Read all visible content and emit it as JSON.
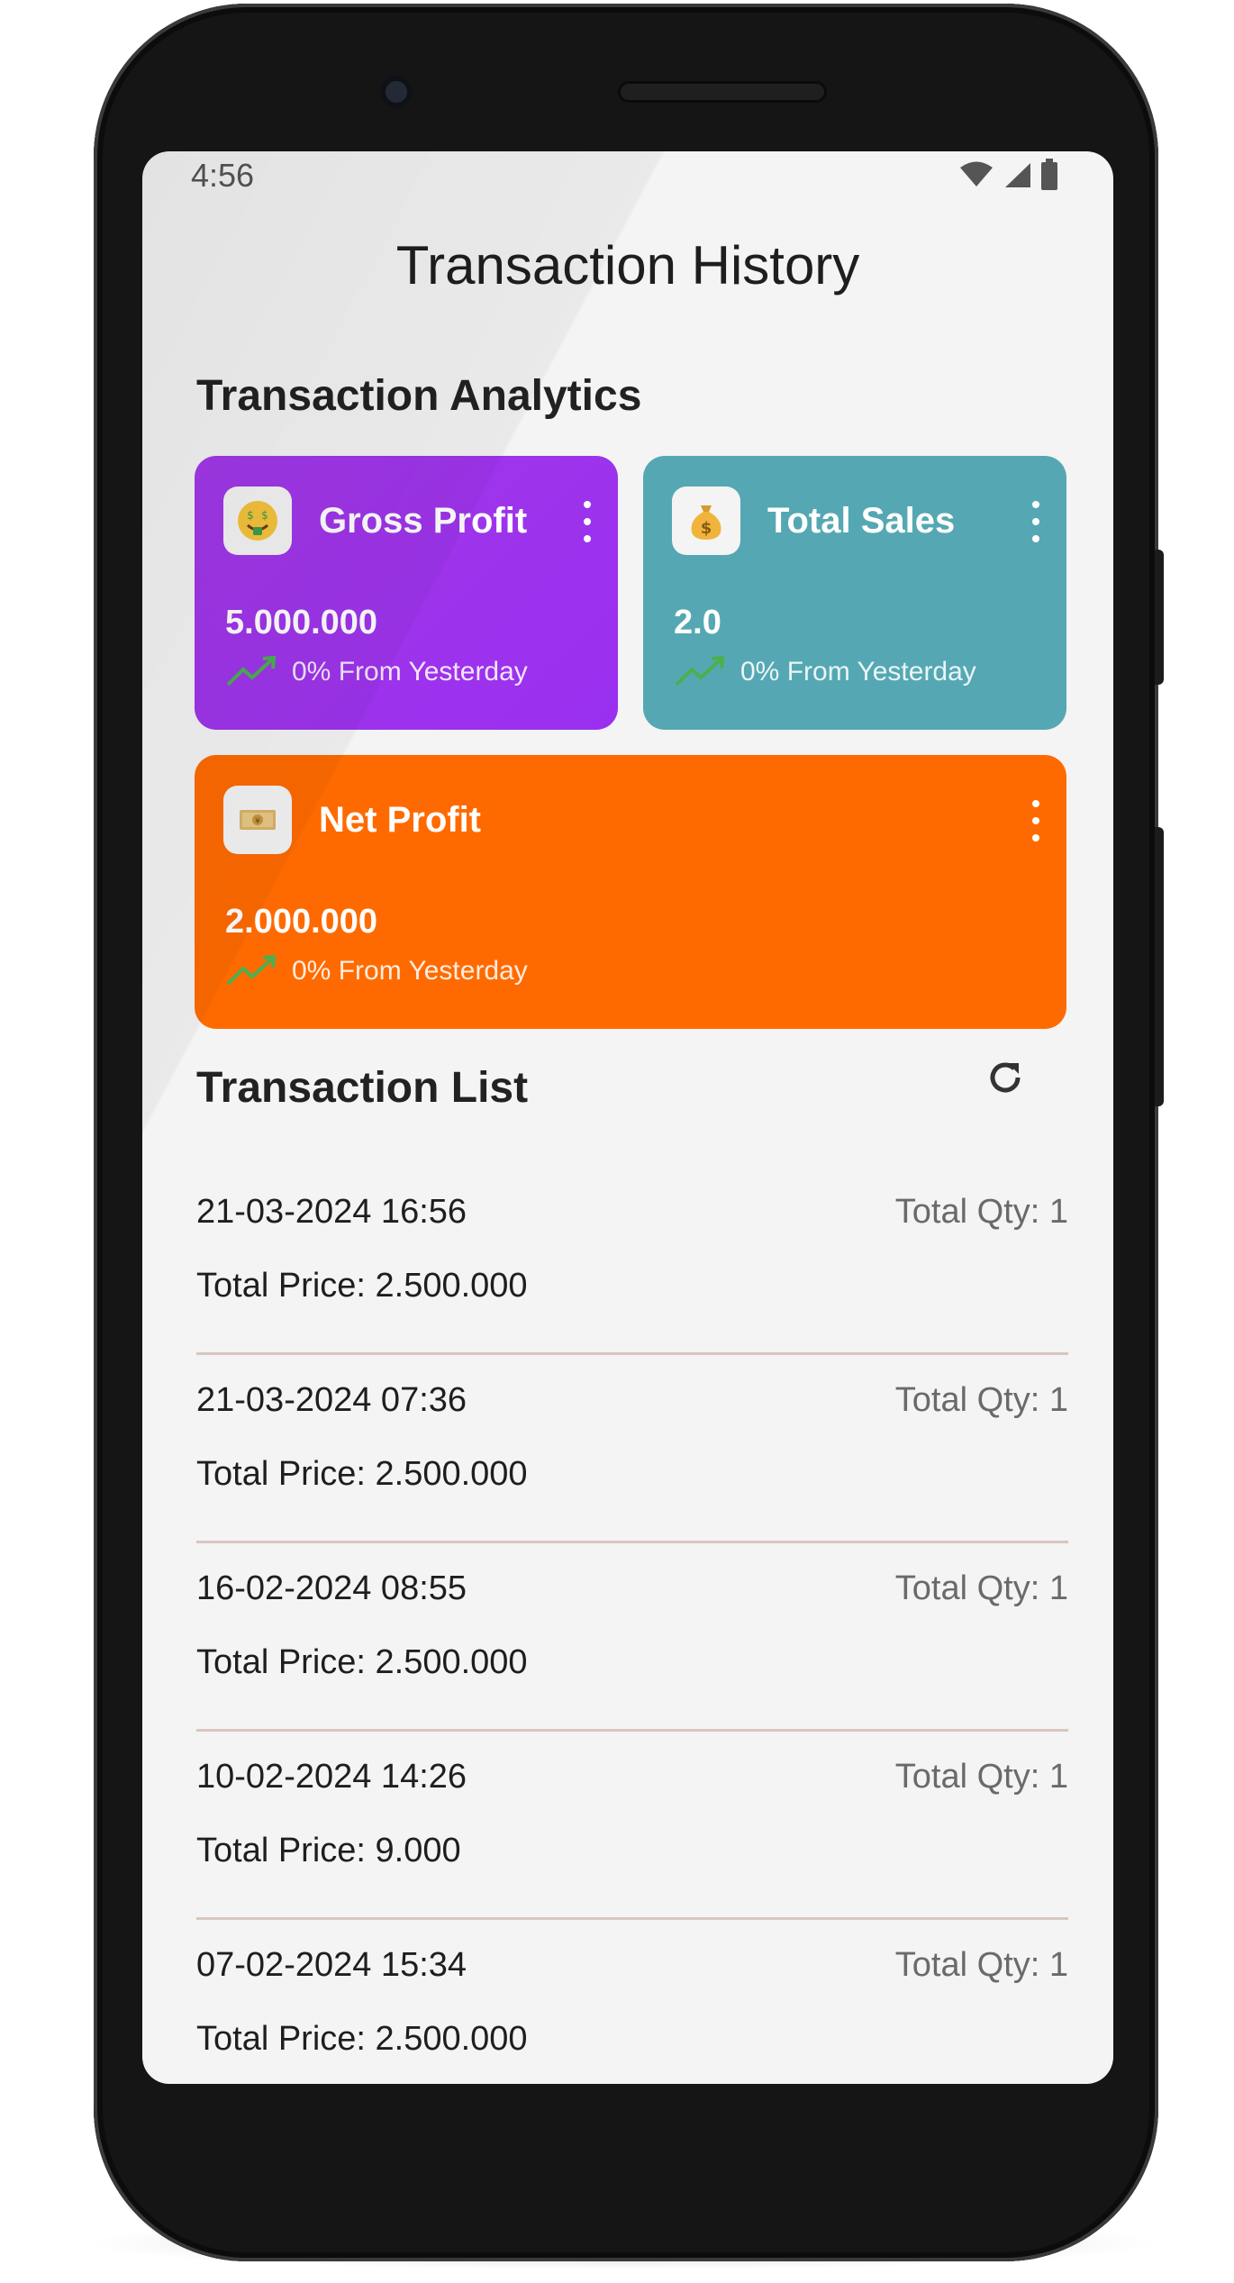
{
  "status_bar": {
    "time": "4:56",
    "icons": [
      "wifi-icon",
      "cell-signal-icon",
      "battery-icon"
    ]
  },
  "header": {
    "title": "Transaction History"
  },
  "analytics": {
    "title": "Transaction Analytics",
    "cards": [
      {
        "label": "Gross Profit",
        "value": "5.000.000",
        "trend": "0% From Yesterday",
        "icon": "money-mouth-face-icon",
        "color": "#9c34e8"
      },
      {
        "label": "Total Sales",
        "value": "2.0",
        "trend": "0% From Yesterday",
        "icon": "money-bag-icon",
        "color": "#55a8b3"
      },
      {
        "label": "Net Profit",
        "value": "2.000.000",
        "trend": "0% From Yesterday",
        "icon": "yen-banknote-icon",
        "color": "#ff6a00"
      }
    ]
  },
  "transactions": {
    "title": "Transaction List",
    "refresh_icon": "refresh-icon",
    "items": [
      {
        "date": "21-03-2024 16:56",
        "qty": "Total Qty: 1",
        "price": "Total Price: 2.500.000"
      },
      {
        "date": "21-03-2024 07:36",
        "qty": "Total Qty: 1",
        "price": "Total Price: 2.500.000"
      },
      {
        "date": "16-02-2024 08:55",
        "qty": "Total Qty: 1",
        "price": "Total Price: 2.500.000"
      },
      {
        "date": "10-02-2024 14:26",
        "qty": "Total Qty: 1",
        "price": "Total Price: 9.000"
      },
      {
        "date": "07-02-2024 15:34",
        "qty": "Total Qty: 1",
        "price": "Total Price: 2.500.000"
      }
    ]
  },
  "colors": {
    "background": "#f4f4f4",
    "trend_green": "#4caf50",
    "divider": "#d9c6bf"
  }
}
